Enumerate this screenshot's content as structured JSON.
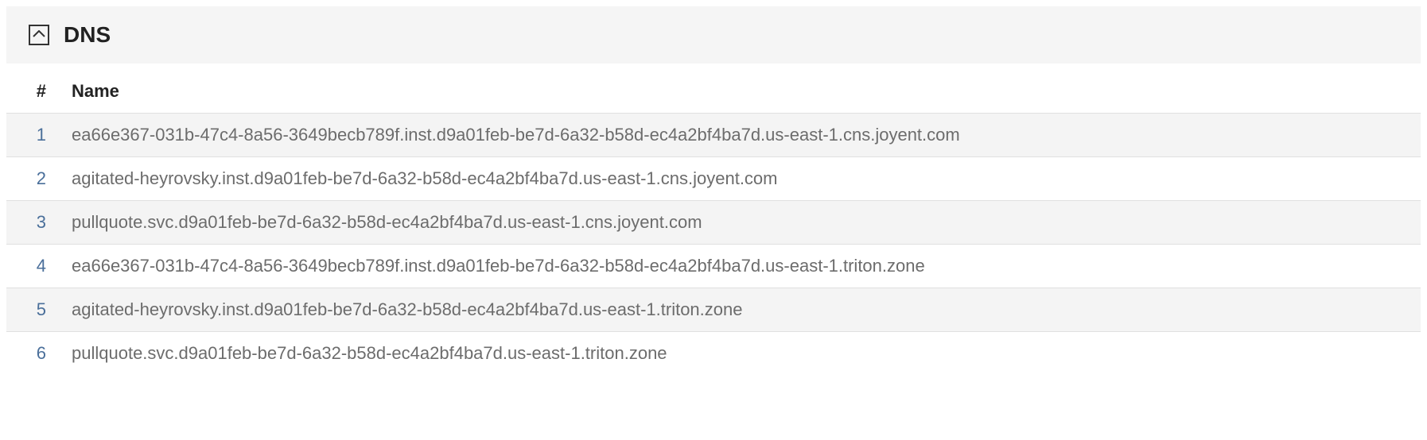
{
  "panel": {
    "title": "DNS"
  },
  "table": {
    "headers": {
      "index": "#",
      "name": "Name"
    },
    "rows": [
      {
        "index": "1",
        "name": "ea66e367-031b-47c4-8a56-3649becb789f.inst.d9a01feb-be7d-6a32-b58d-ec4a2bf4ba7d.us-east-1.cns.joyent.com"
      },
      {
        "index": "2",
        "name": "agitated-heyrovsky.inst.d9a01feb-be7d-6a32-b58d-ec4a2bf4ba7d.us-east-1.cns.joyent.com"
      },
      {
        "index": "3",
        "name": "pullquote.svc.d9a01feb-be7d-6a32-b58d-ec4a2bf4ba7d.us-east-1.cns.joyent.com"
      },
      {
        "index": "4",
        "name": "ea66e367-031b-47c4-8a56-3649becb789f.inst.d9a01feb-be7d-6a32-b58d-ec4a2bf4ba7d.us-east-1.triton.zone"
      },
      {
        "index": "5",
        "name": "agitated-heyrovsky.inst.d9a01feb-be7d-6a32-b58d-ec4a2bf4ba7d.us-east-1.triton.zone"
      },
      {
        "index": "6",
        "name": "pullquote.svc.d9a01feb-be7d-6a32-b58d-ec4a2bf4ba7d.us-east-1.triton.zone"
      }
    ]
  }
}
